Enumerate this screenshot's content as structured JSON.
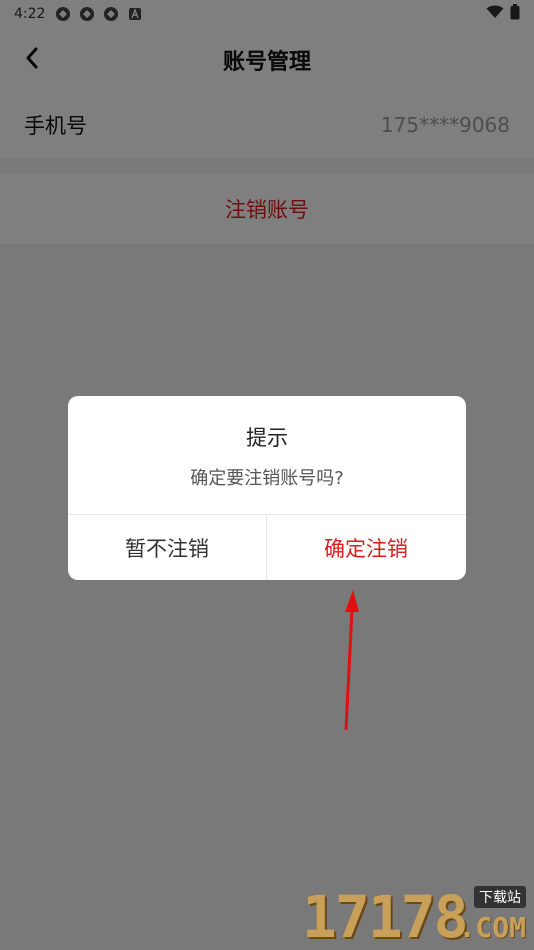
{
  "status_bar": {
    "time": "4:22",
    "icons": [
      "app-circle-icon",
      "app-circle-icon",
      "app-circle-icon",
      "a-box-icon"
    ],
    "right_icons": [
      "wifi-icon",
      "battery-icon"
    ]
  },
  "nav": {
    "title": "账号管理",
    "back_icon": "chevron-left-icon"
  },
  "account": {
    "phone_label": "手机号",
    "phone_value": "175****9068",
    "cancel_account_label": "注销账号"
  },
  "dialog": {
    "title": "提示",
    "message": "确定要注销账号吗?",
    "cancel_label": "暂不注销",
    "confirm_label": "确定注销"
  },
  "watermark": {
    "number": "17178",
    "site_label": "下载站",
    "domain": ".COM"
  },
  "colors": {
    "accent_red": "#d81e1e",
    "overlay": "rgba(0,0,0,0.5)"
  }
}
